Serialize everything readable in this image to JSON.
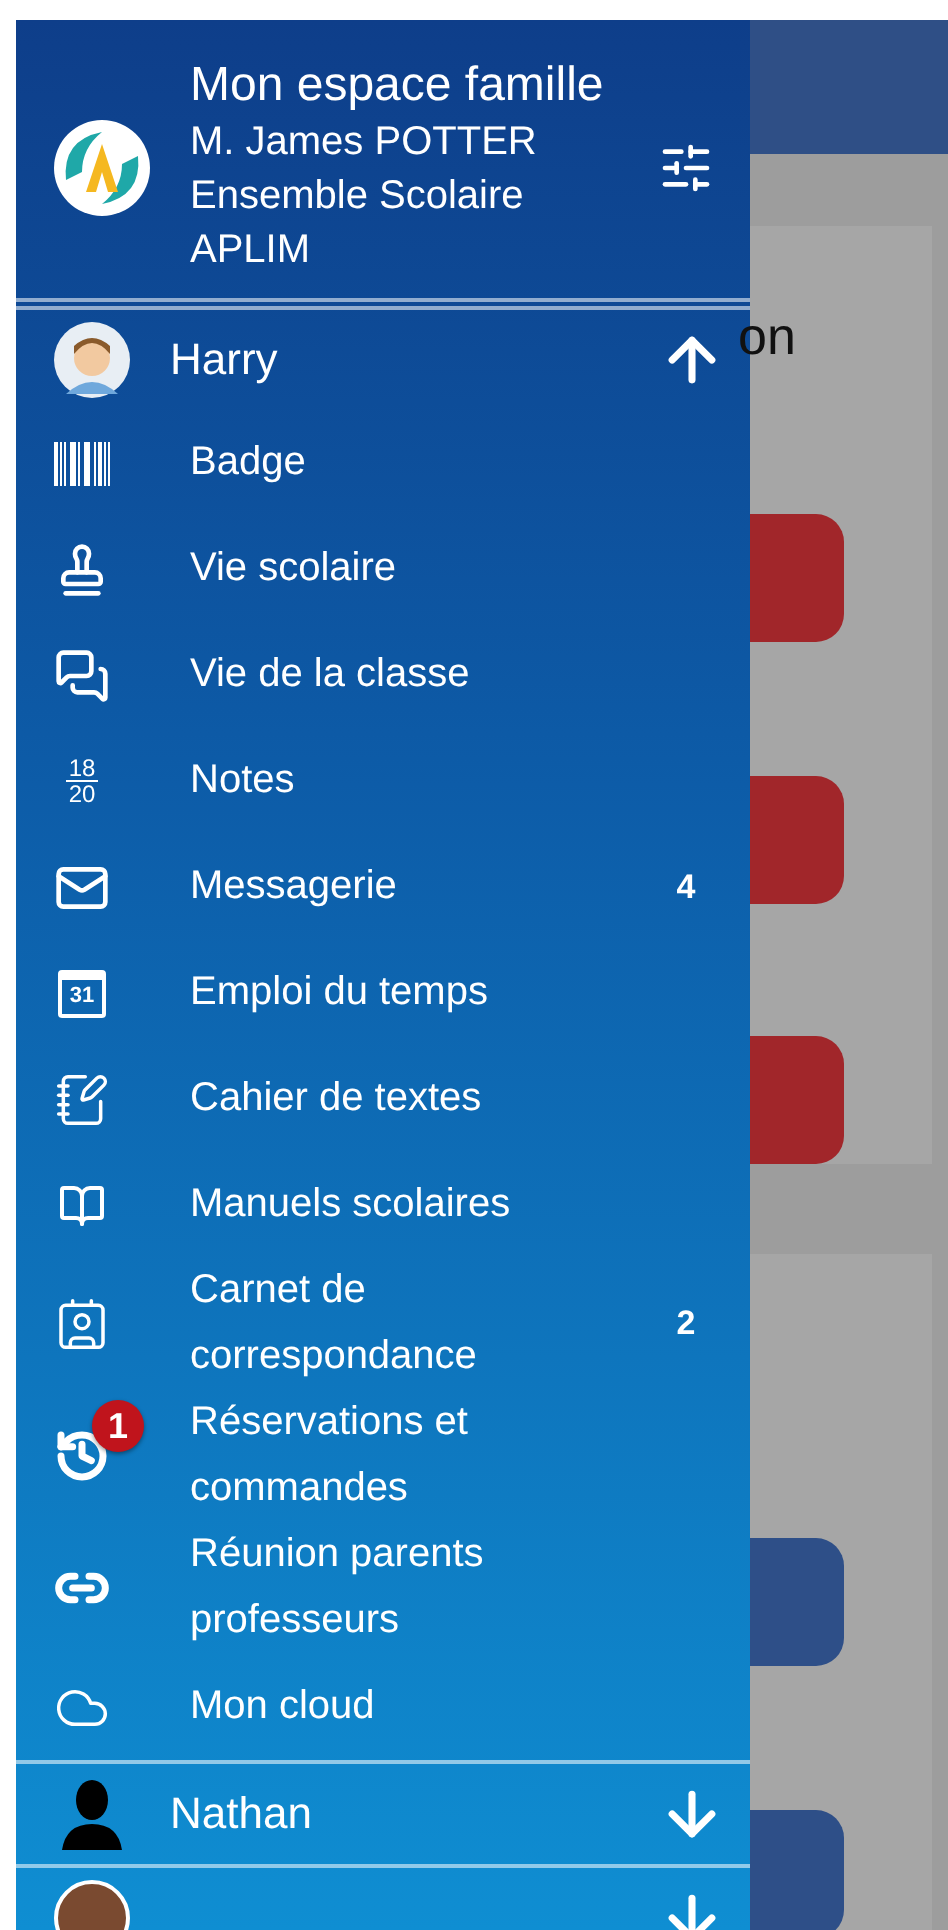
{
  "background": {
    "card_title_fragment": "on"
  },
  "drawer": {
    "header": {
      "title": "Mon espace famille",
      "user": "M. James POTTER",
      "school_lines": [
        "Ensemble Scolaire",
        "APLIM"
      ]
    },
    "children": [
      {
        "name": "Harry",
        "kind": "cartoon",
        "expanded": true,
        "menu": [
          {
            "label": "Badge"
          },
          {
            "label": "Vie scolaire"
          },
          {
            "label": "Vie de la classe"
          },
          {
            "label": "Notes",
            "icon_text": [
              "18",
              "20"
            ]
          },
          {
            "label": "Messagerie",
            "count": "4"
          },
          {
            "label": "Emploi du temps",
            "icon_text": [
              "31"
            ]
          },
          {
            "label": "Cahier de textes"
          },
          {
            "label": "Manuels scolaires"
          },
          {
            "label": "Carnet de correspondance",
            "count": "2"
          },
          {
            "label": "Réservations et commandes",
            "alert": "1"
          },
          {
            "label": "Réunion parents professeurs"
          },
          {
            "label": "Mon cloud"
          }
        ]
      },
      {
        "name": "Nathan",
        "kind": "silhouette",
        "expanded": false
      },
      {
        "kind": "photo",
        "expanded": false
      }
    ]
  }
}
